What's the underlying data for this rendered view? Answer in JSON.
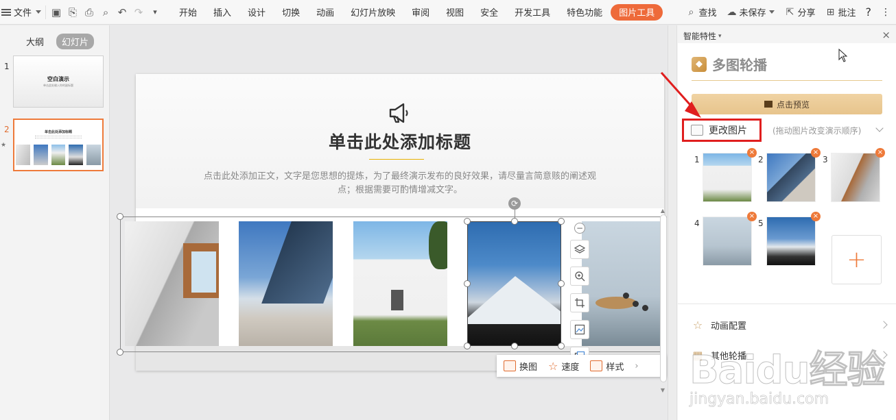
{
  "menu": {
    "file_label": "文件",
    "tabs": [
      {
        "label": "开始"
      },
      {
        "label": "插入"
      },
      {
        "label": "设计"
      },
      {
        "label": "切换"
      },
      {
        "label": "动画"
      },
      {
        "label": "幻灯片放映"
      },
      {
        "label": "审阅"
      },
      {
        "label": "视图"
      },
      {
        "label": "安全"
      },
      {
        "label": "开发工具"
      },
      {
        "label": "特色功能"
      },
      {
        "label": "图片工具"
      }
    ],
    "active_tab": "图片工具",
    "search_label": "查找",
    "save_status": "未保存",
    "share_label": "分享",
    "comment_label": "批注",
    "help_label": "?",
    "accent_color": "#ee6a3a"
  },
  "left_pane": {
    "tabs": [
      {
        "label": "大纲"
      },
      {
        "label": "幻灯片"
      }
    ],
    "active_tab": "幻灯片",
    "slides": [
      {
        "number": "1",
        "title": "空白演示",
        "subtitle": "单击此处输入你的副标题"
      },
      {
        "number": "2",
        "title": "单击此处添加标题"
      }
    ],
    "active_slide": "2"
  },
  "slide": {
    "title": "单击此处添加标题",
    "body": "点击此处添加正文，文字是您思想的提炼，为了最终演示发布的良好效果，请尽量言简意赅的阐述观点；根据需要可酌情增减文字。"
  },
  "float_toolbar": {
    "replace_label": "换图",
    "effect_label": "速度",
    "style_label": "样式"
  },
  "right_panel": {
    "header": "智能特性",
    "title": "多图轮播",
    "preview_label": "点击预览",
    "change_label": "更改图片",
    "hint": "(拖动图片改变演示顺序)",
    "images": [
      {
        "number": "1",
        "name": "white-building"
      },
      {
        "number": "2",
        "name": "blue-building"
      },
      {
        "number": "3",
        "name": "window-interior"
      },
      {
        "number": "4",
        "name": "still-life-table"
      },
      {
        "number": "5",
        "name": "snowy-mountain"
      }
    ],
    "add_label": "+",
    "rows": [
      {
        "label": "动画配置",
        "icon": "star-icon"
      },
      {
        "label": "其他轮播",
        "icon": "grid-icon"
      }
    ]
  },
  "watermark": {
    "brand": "Baidu经验",
    "url": "jingyan.baidu.com"
  }
}
